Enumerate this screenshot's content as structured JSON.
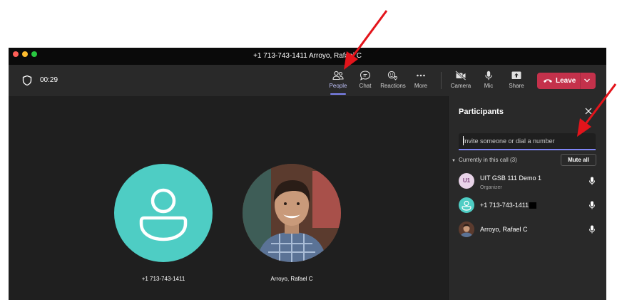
{
  "window": {
    "title": "+1 713-743-1411  Arroyo, Rafael C",
    "traffic_light_colors": [
      "#fe5f57",
      "#febc2e",
      "#28c840"
    ]
  },
  "toolbar": {
    "timer": "00:29",
    "people_label": "People",
    "chat_label": "Chat",
    "reactions_label": "Reactions",
    "more_label": "More",
    "camera_label": "Camera",
    "mic_label": "Mic",
    "share_label": "Share",
    "leave_label": "Leave",
    "active_tab": "People"
  },
  "stage": {
    "tiles": [
      {
        "name": "+1 713-743-1411",
        "avatar": "person-icon",
        "avatar_color": "#4ecdc4"
      },
      {
        "name": "Arroyo, Rafael C",
        "avatar": "photo"
      }
    ]
  },
  "participants_panel": {
    "title": "Participants",
    "invite_placeholder": "Invite someone or dial a number",
    "section_label": "Currently in this call (3)",
    "mute_all_label": "Mute all",
    "participants": [
      {
        "name": "UIT GSB 111 Demo 1",
        "role": "Organizer",
        "initials": "U1",
        "avatar_color": "#e8d3e8"
      },
      {
        "name": "+1 713-743-1411",
        "role": "",
        "avatar_color": "#4ecdc4"
      },
      {
        "name": "Arroyo, Rafael C",
        "role": "",
        "avatar": "photo"
      }
    ]
  },
  "colors": {
    "accent": "#7f85f5",
    "leave": "#c4314b",
    "annotation_arrow": "#e3141b"
  }
}
